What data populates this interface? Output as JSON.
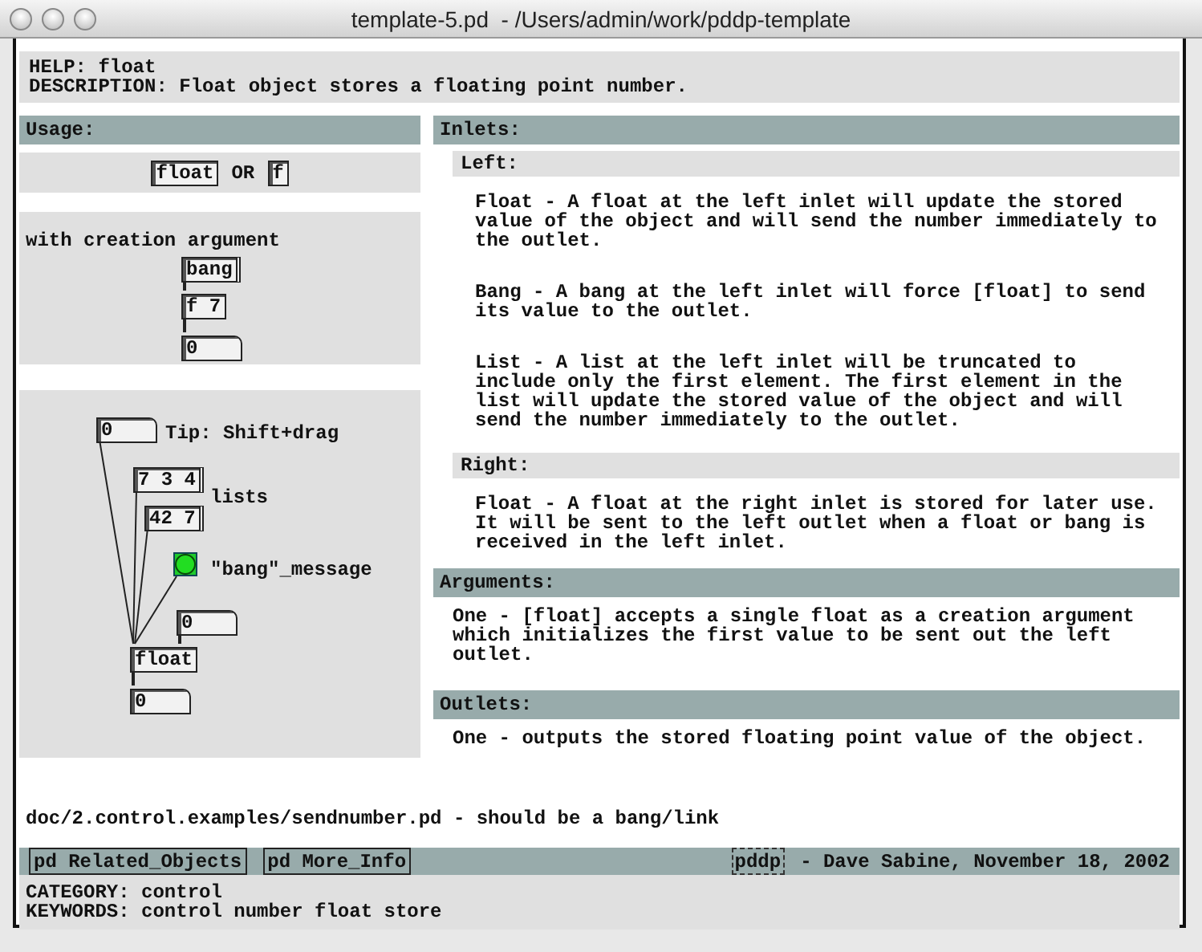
{
  "window": {
    "title": "template-5.pd  - /Users/admin/work/pddp-template"
  },
  "header": {
    "help": "HELP: float",
    "description": "DESCRIPTION: Float object stores a floating point number."
  },
  "usage": {
    "title": "Usage:",
    "items": [
      {
        "kind": "object",
        "text": "float"
      },
      {
        "kind": "label",
        "text": "OR"
      },
      {
        "kind": "object",
        "text": "f"
      }
    ]
  },
  "creation_example": {
    "caption": "with creation argument",
    "boxes": [
      {
        "kind": "message",
        "text": "bang"
      },
      {
        "kind": "object",
        "text": "f 7"
      },
      {
        "kind": "number",
        "text": "0"
      }
    ]
  },
  "patch_example": {
    "boxes": [
      {
        "kind": "number",
        "text": "0"
      },
      {
        "kind": "comment",
        "text": "Tip: Shift+drag"
      },
      {
        "kind": "message",
        "text": "7 3 4"
      },
      {
        "kind": "comment",
        "text": "lists"
      },
      {
        "kind": "message",
        "text": "42 7"
      },
      {
        "kind": "bang"
      },
      {
        "kind": "comment",
        "text": "\"bang\"_message"
      },
      {
        "kind": "number",
        "text": "0"
      },
      {
        "kind": "object",
        "text": "float"
      },
      {
        "kind": "number",
        "text": "0"
      }
    ]
  },
  "reference": [
    {
      "kind": "header",
      "text": "Inlets:"
    },
    {
      "kind": "subheader",
      "text": "Left:"
    },
    {
      "kind": "paragraph",
      "text": "Float - A float at the left inlet will update the stored\nvalue of the object and will send the number immediately to\nthe outlet."
    },
    {
      "kind": "paragraph",
      "text": "Bang - A bang at the left inlet will force [float] to send\nits value to the outlet."
    },
    {
      "kind": "paragraph",
      "text": "List - A list at the left inlet will be truncated to\ninclude only the first element. The first element in the\nlist will update the stored value of the object and will\nsend the number immediately to the outlet."
    },
    {
      "kind": "subheader",
      "text": "Right:"
    },
    {
      "kind": "paragraph",
      "text": "Float - A float at the right inlet is stored for later use.\nIt will be sent to the left outlet when a float or bang is\nreceived in the left inlet."
    },
    {
      "kind": "header",
      "text": "Arguments:"
    },
    {
      "kind": "note",
      "text": "One - [float] accepts a single float as a creation argument\nwhich initializes the first value to be sent out the left\noutlet."
    },
    {
      "kind": "header",
      "text": "Outlets:"
    },
    {
      "kind": "note",
      "text": "One - outputs the stored floating point value of the object."
    }
  ],
  "note": "doc/2.control.examples/sendnumber.pd - should be a bang/link",
  "footer": {
    "subpatches": [
      "pd Related_Objects",
      "pd More_Info"
    ],
    "tag": "pddp",
    "credit": "- Dave Sabine, November 18, 2002"
  },
  "meta": {
    "category": "CATEGORY: control",
    "keywords": "KEYWORDS: control number float store"
  }
}
